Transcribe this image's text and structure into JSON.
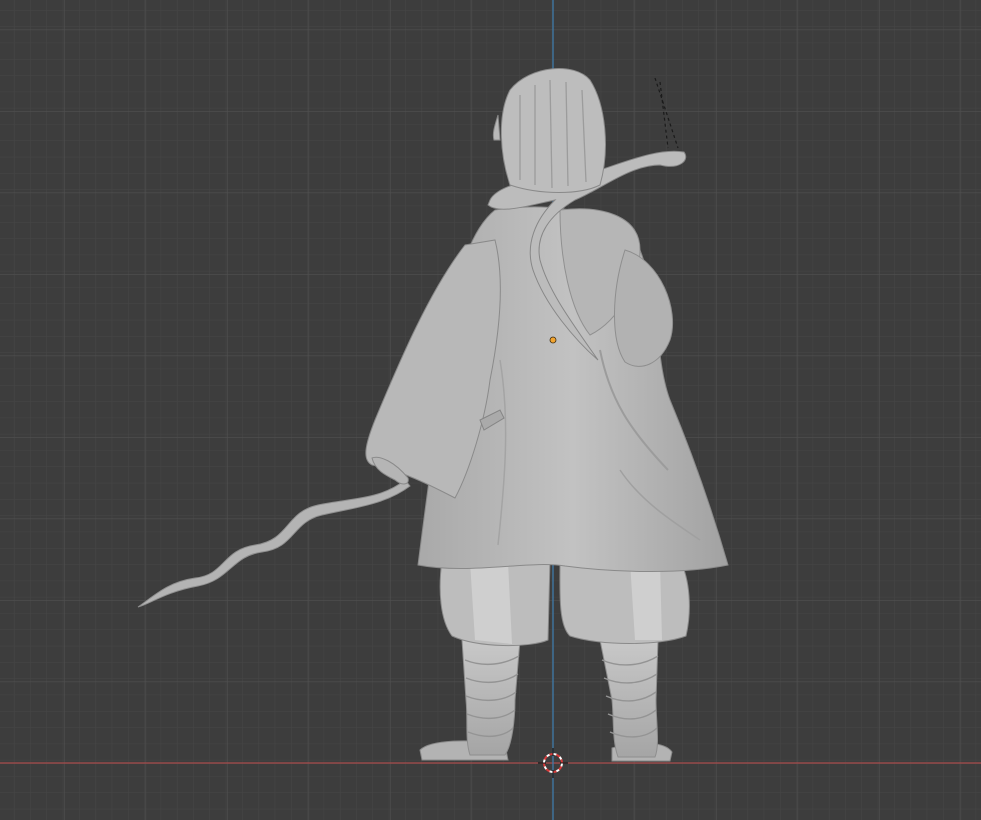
{
  "viewport": {
    "background_color": "#3d3d3d",
    "grid_minor_color": "#454545",
    "grid_major_color": "#4e4e4e",
    "x_axis_color": "#a84b4b",
    "z_axis_color": "#3e79a8",
    "model_color": "#b9b9b9",
    "origin_dot_color": "#f2a42f"
  },
  "icons": {
    "origin": "object-origin-icon",
    "cursor": "3d-cursor-icon",
    "bone_line": "dashed-relationship-line-icon"
  }
}
